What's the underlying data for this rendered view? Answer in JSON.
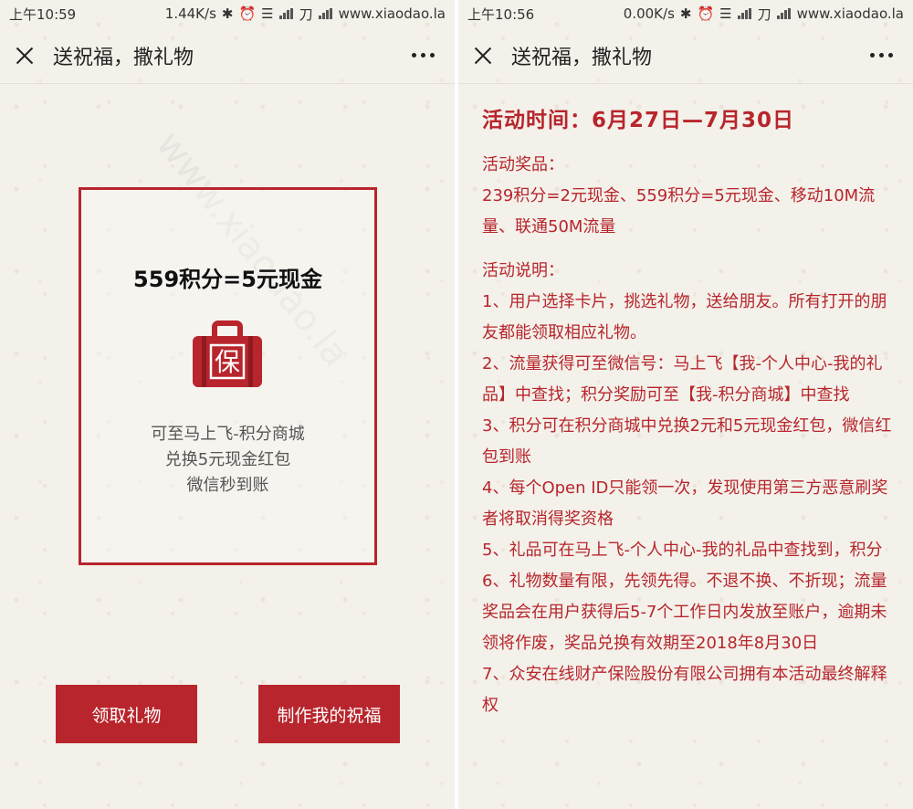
{
  "left": {
    "status": {
      "time": "上午10:59",
      "speed": "1.44K/s",
      "carrier": "刀",
      "site": "www.xiaodao.la"
    },
    "nav": {
      "title": "送祝福，撒礼物"
    },
    "card": {
      "title": "559积分=5元现金",
      "icon_text": "保",
      "lines": [
        "可至马上飞-积分商城",
        "兑换5元现金红包",
        "微信秒到账"
      ]
    },
    "buttons": {
      "claim": "领取礼物",
      "make": "制作我的祝福"
    },
    "watermark": "www.xiaodao.la"
  },
  "right": {
    "status": {
      "time": "上午10:56",
      "speed": "0.00K/s",
      "carrier": "刀",
      "site": "www.xiaodao.la"
    },
    "nav": {
      "title": "送祝福，撒礼物"
    },
    "time_title": "活动时间：6月27日—7月30日",
    "prizes_label": "活动奖品：",
    "prizes_text": "239积分=2元现金、559积分=5元现金、移动10M流量、联通50M流量",
    "rules_label": "活动说明：",
    "rules": [
      "1、用户选择卡片，挑选礼物，送给朋友。所有打开的朋友都能领取相应礼物。",
      "2、流量获得可至微信号：马上飞【我-个人中心-我的礼品】中查找；积分奖励可至【我-积分商城】中查找",
      "3、积分可在积分商城中兑换2元和5元现金红包，微信红包到账",
      "4、每个Open ID只能领一次，发现使用第三方恶意刷奖者将取消得奖资格",
      "5、礼品可在马上飞-个人中心-我的礼品中查找到，积分",
      "6、礼物数量有限，先领先得。不退不换、不折现；流量奖品会在用户获得后5-7个工作日内发放至账户，逾期未领将作废，奖品兑换有效期至2018年8月30日",
      "7、众安在线财产保险股份有限公司拥有本活动最终解释权"
    ]
  },
  "colors": {
    "accent": "#b8252c",
    "background": "#f3f1ea"
  }
}
